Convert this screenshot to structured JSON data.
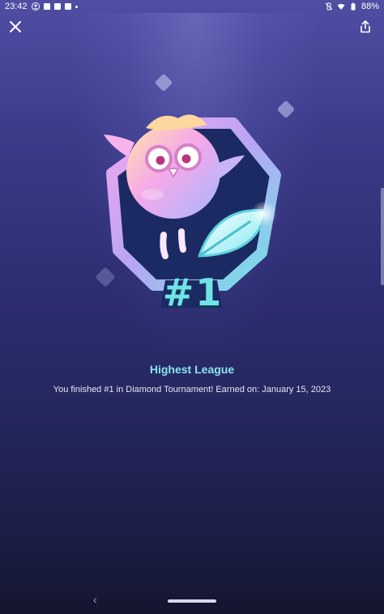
{
  "status_bar": {
    "time": "23:42",
    "battery": "88%",
    "left_icons": [
      "account-icon",
      "facebook-icon",
      "facebook-icon",
      "messenger-icon",
      "dot-icon"
    ],
    "right_icons": [
      "vibrate-off-icon",
      "wifi-icon",
      "battery-icon"
    ]
  },
  "toolbar": {
    "close_icon": "close-icon",
    "share_icon": "share-icon"
  },
  "badge": {
    "rank_text": "#1",
    "icon": "owl-trophy-badge-icon"
  },
  "achievement": {
    "title": "Highest League",
    "description": "You finished #1 in Diamond Tournament! Earned on: January 15, 2023"
  },
  "navigation": {
    "back_icon": "back-chevron-icon",
    "home_icon": "home-pill-icon"
  },
  "colors": {
    "title": "#8be3ef",
    "background_top": "#4f4ea3",
    "background_bottom": "#14162f"
  }
}
